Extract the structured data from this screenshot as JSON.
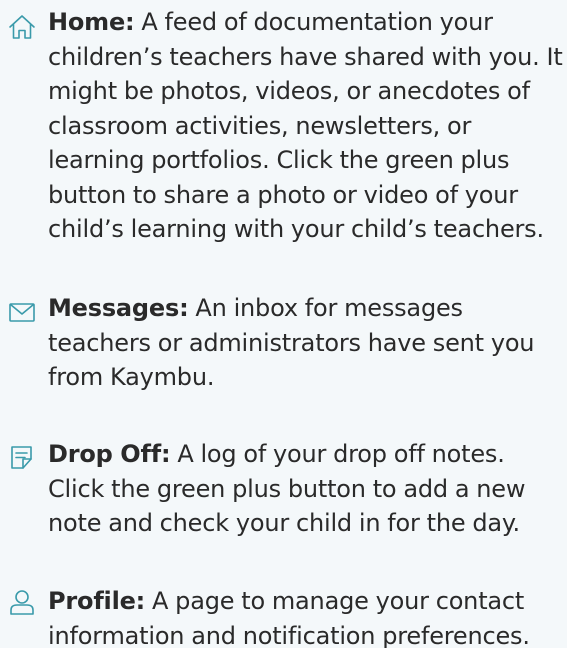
{
  "accent_color": "#3a9aaa",
  "items": [
    {
      "icon": "home-icon",
      "term": "Home:",
      "description": "A feed of documentation your children’s teachers have shared with you. It might be photos, videos, or anecdotes of classroom activities, newsletters, or learning portfolios. Click the green plus button to share a photo or video of your child’s learning with your child’s teachers."
    },
    {
      "icon": "envelope-icon",
      "term": "Messages:",
      "description": "An inbox for messages teachers or administrators have sent you from Kaymbu."
    },
    {
      "icon": "note-icon",
      "term": "Drop Off:",
      "description": "A log of your drop off notes. Click the green plus button to add a new note and check your child in for the day."
    },
    {
      "icon": "user-icon",
      "term": "Profile:",
      "description": "A page to manage your contact information and notification preferences."
    }
  ]
}
